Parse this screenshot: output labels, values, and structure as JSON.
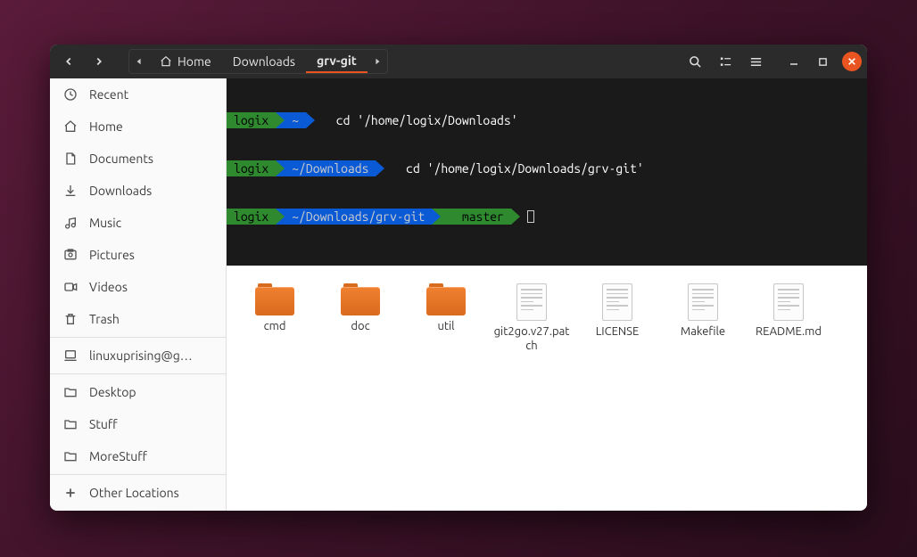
{
  "breadcrumb": {
    "home": "Home",
    "downloads": "Downloads",
    "current": "grv-git"
  },
  "sidebar": {
    "recent": "Recent",
    "home": "Home",
    "documents": "Documents",
    "downloads": "Downloads",
    "music": "Music",
    "pictures": "Pictures",
    "videos": "Videos",
    "trash": "Trash",
    "remote": "linuxuprising@g…",
    "desktop": "Desktop",
    "stuff": "Stuff",
    "morestuff": "MoreStuff",
    "other": "Other Locations"
  },
  "terminal": {
    "user": "logix",
    "row1_dir": "~",
    "row1_cmd": "  cd '/home/logix/Downloads'",
    "row2_dir": "~/Downloads",
    "row2_cmd": "  cd '/home/logix/Downloads/grv-git'",
    "row3_dir": "~/Downloads/grv-git",
    "branch": "  master"
  },
  "files": {
    "cmd": "cmd",
    "doc": "doc",
    "util": "util",
    "patch": "git2go.v27.patch",
    "license": "LICENSE",
    "makefile": "Makefile",
    "readme": "README.md"
  }
}
